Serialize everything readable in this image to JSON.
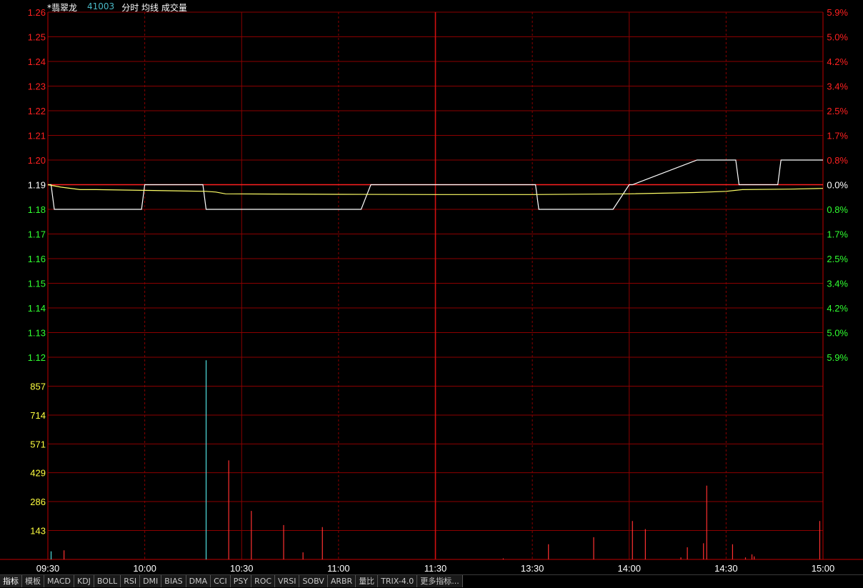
{
  "header": {
    "stock_name": "*翡翠龙",
    "code": "41003",
    "view_label": "分时 均线 成交量"
  },
  "toolbar": {
    "items": [
      "指标",
      "模板",
      "MACD",
      "KDJ",
      "BOLL",
      "RSI",
      "DMI",
      "BIAS",
      "DMA",
      "CCI",
      "PSY",
      "ROC",
      "VRSI",
      "SOBV",
      "ARBR",
      "量比",
      "TRIX-4.0",
      "更多指标..."
    ]
  },
  "colors": {
    "background": "#000000",
    "grid": "#8b0000",
    "axis": "#c00000",
    "price_up": "#ff2020",
    "price_flat": "#ffffff",
    "price_down": "#30ff30",
    "volume_label": "#ffff40",
    "price_line": "#ffffff",
    "avg_line": "#ffff66",
    "volume_up": "#ff3030",
    "volume_big": "#50e0e0"
  },
  "chart_data": {
    "type": "line",
    "prev_close": 1.19,
    "price_axis": {
      "ticks": [
        "1.26",
        "1.25",
        "1.24",
        "1.23",
        "1.22",
        "1.21",
        "1.20",
        "1.19",
        "1.18",
        "1.17",
        "1.16",
        "1.15",
        "1.14",
        "1.13",
        "1.12"
      ],
      "ylim": [
        1.12,
        1.26
      ]
    },
    "pct_axis": {
      "ticks": [
        "5.9%",
        "5.0%",
        "4.2%",
        "3.4%",
        "2.5%",
        "1.7%",
        "0.8%",
        "0.0%",
        "0.8%",
        "1.7%",
        "2.5%",
        "3.4%",
        "4.2%",
        "5.0%",
        "5.9%"
      ]
    },
    "time_axis": {
      "ticks": [
        "09:30",
        "10:00",
        "10:30",
        "11:00",
        "11:30",
        "13:30",
        "14:00",
        "14:30",
        "15:00"
      ],
      "minutes_total": 240
    },
    "series": [
      {
        "name": "分时",
        "x": [
          0,
          1,
          2,
          29,
          30,
          48,
          49,
          96,
          97,
          100,
          151,
          152,
          174,
          175,
          180,
          181,
          201,
          202,
          213,
          214,
          226,
          227,
          240
        ],
        "values": [
          1.19,
          1.19,
          1.18,
          1.18,
          1.19,
          1.19,
          1.18,
          1.18,
          1.18,
          1.19,
          1.19,
          1.18,
          1.18,
          1.18,
          1.19,
          1.19,
          1.2,
          1.2,
          1.2,
          1.19,
          1.19,
          1.2,
          1.2
        ]
      },
      {
        "name": "均线",
        "x": [
          0,
          4,
          10,
          15,
          49,
          52,
          55,
          70,
          90,
          120,
          150,
          180,
          200,
          210,
          215,
          230,
          240
        ],
        "values": [
          1.19,
          1.189,
          1.188,
          1.188,
          1.1873,
          1.187,
          1.1863,
          1.1862,
          1.1861,
          1.186,
          1.186,
          1.1863,
          1.1868,
          1.1873,
          1.188,
          1.1882,
          1.1885
        ]
      }
    ],
    "volume": {
      "ticks": [
        "857",
        "714",
        "571",
        "429",
        "286",
        "143"
      ],
      "ylim": [
        0,
        1000
      ],
      "bars": [
        {
          "x": 1,
          "v": 40,
          "color": "cyan"
        },
        {
          "x": 5,
          "v": 45,
          "color": "red"
        },
        {
          "x": 49,
          "v": 985,
          "color": "cyan"
        },
        {
          "x": 56,
          "v": 490,
          "color": "red"
        },
        {
          "x": 63,
          "v": 240,
          "color": "red"
        },
        {
          "x": 73,
          "v": 170,
          "color": "red"
        },
        {
          "x": 79,
          "v": 35,
          "color": "red"
        },
        {
          "x": 85,
          "v": 160,
          "color": "red"
        },
        {
          "x": 141,
          "v": 5,
          "color": "red"
        },
        {
          "x": 155,
          "v": 75,
          "color": "red"
        },
        {
          "x": 169,
          "v": 110,
          "color": "red"
        },
        {
          "x": 181,
          "v": 190,
          "color": "red"
        },
        {
          "x": 185,
          "v": 150,
          "color": "red"
        },
        {
          "x": 196,
          "v": 10,
          "color": "red"
        },
        {
          "x": 198,
          "v": 60,
          "color": "red"
        },
        {
          "x": 203,
          "v": 80,
          "color": "red"
        },
        {
          "x": 204,
          "v": 365,
          "color": "red"
        },
        {
          "x": 212,
          "v": 75,
          "color": "red"
        },
        {
          "x": 216,
          "v": 10,
          "color": "red"
        },
        {
          "x": 218,
          "v": 25,
          "color": "red"
        },
        {
          "x": 218.7,
          "v": 15,
          "color": "red"
        },
        {
          "x": 239,
          "v": 190,
          "color": "red"
        }
      ]
    }
  }
}
